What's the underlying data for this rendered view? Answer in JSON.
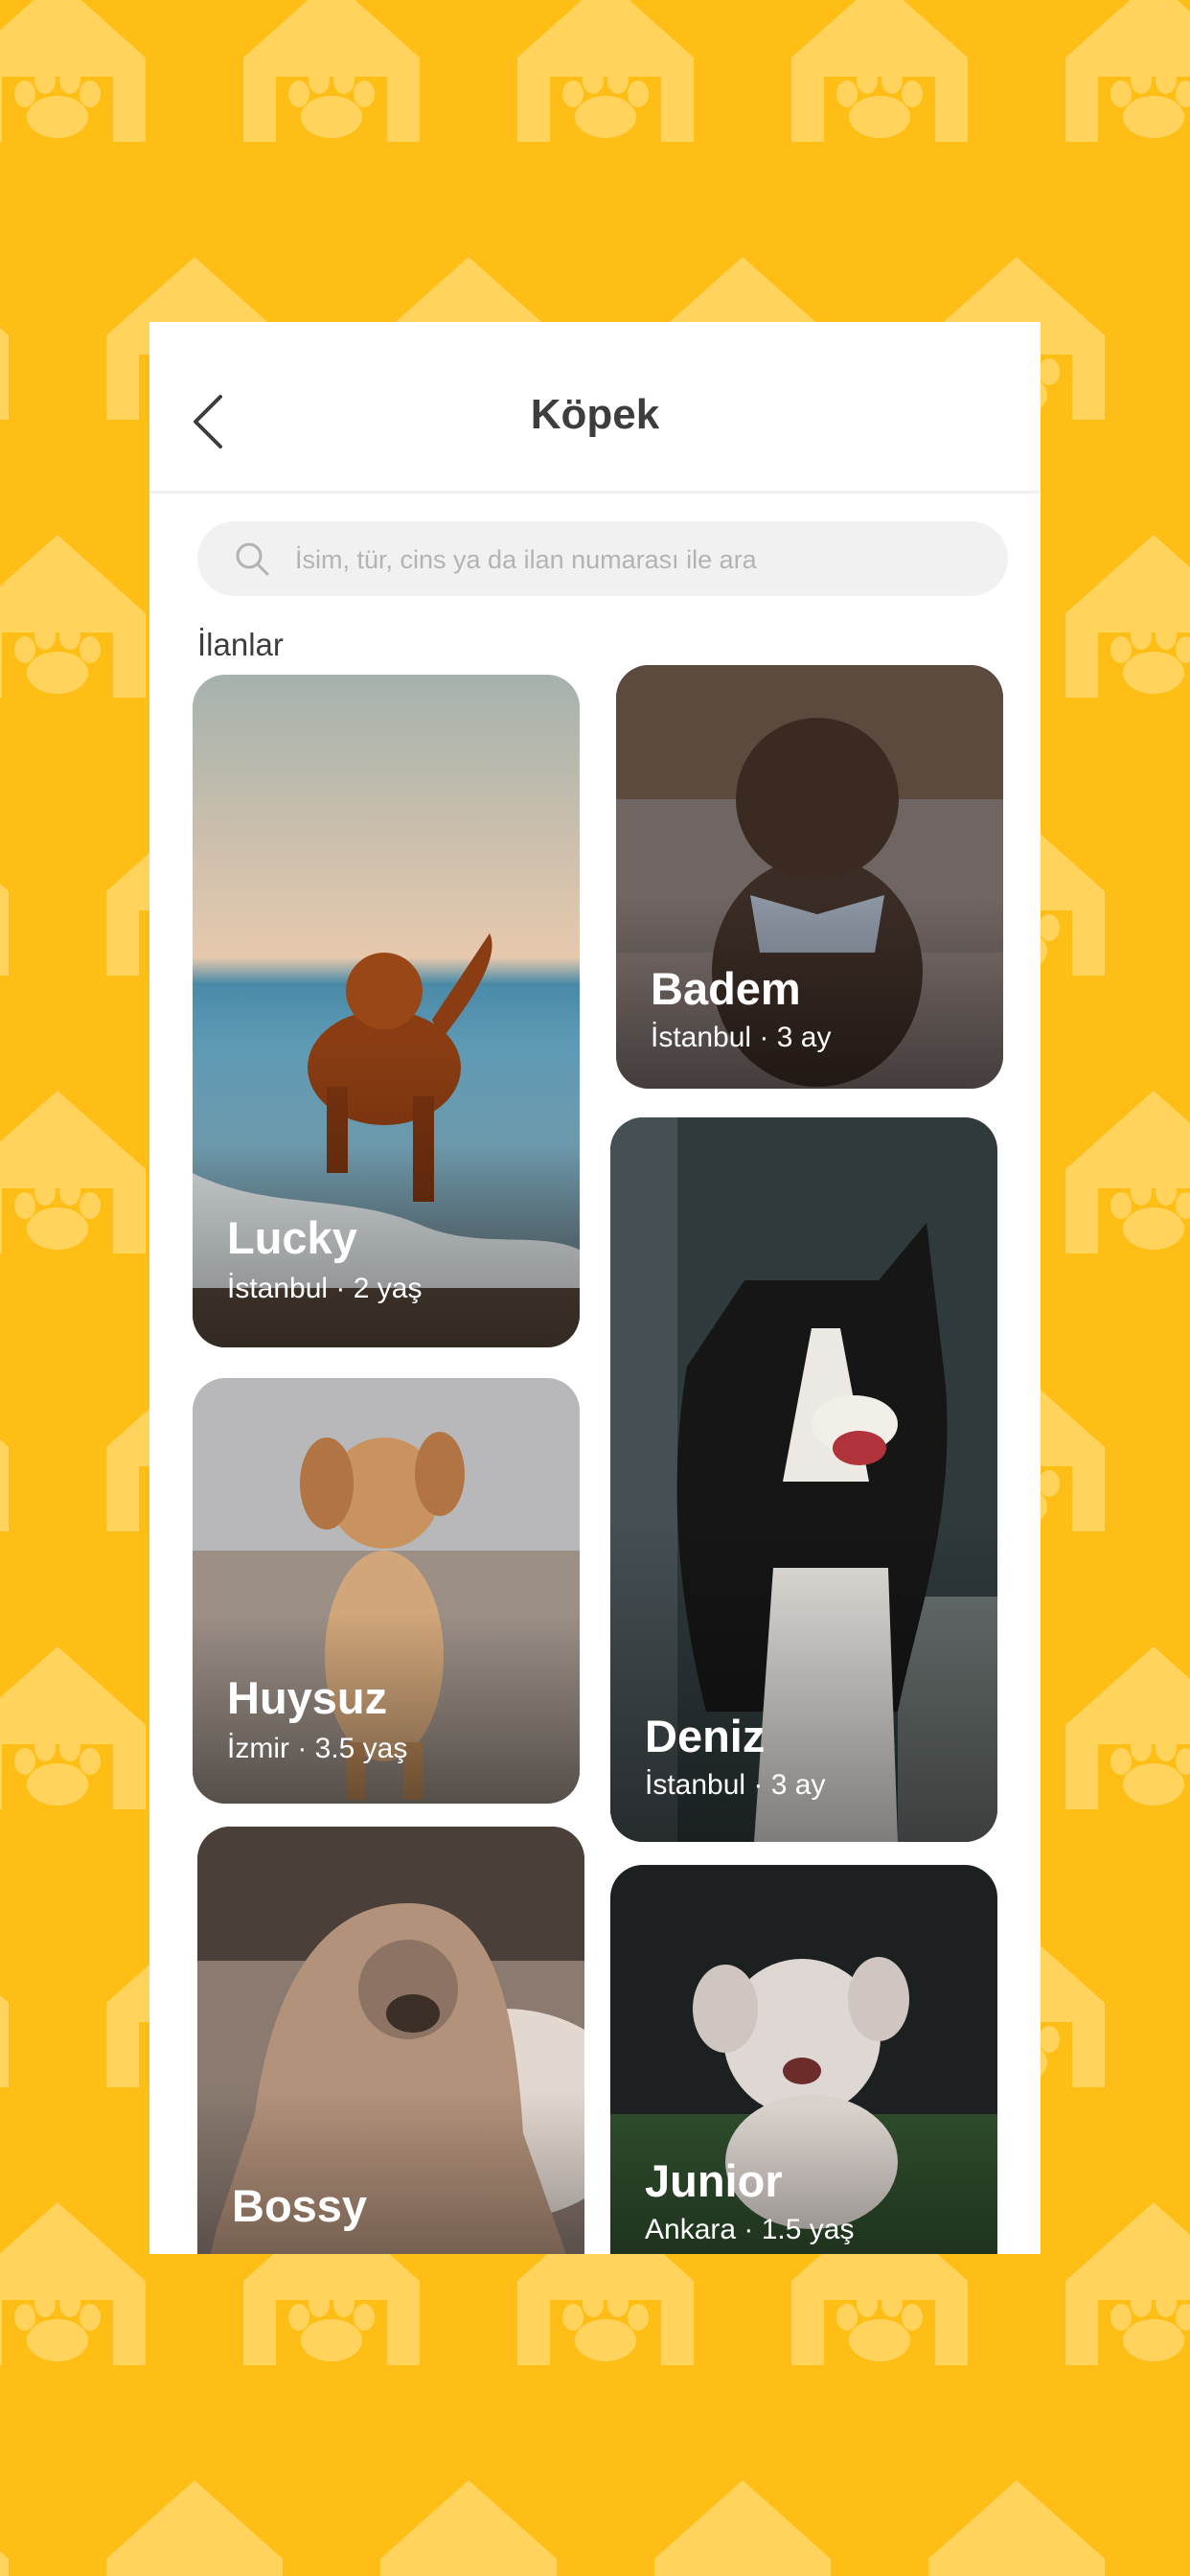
{
  "header": {
    "title": "Köpek",
    "back_icon": "chevron-left-icon"
  },
  "search": {
    "placeholder": "İsim, tür, cins ya da ilan numarası ile ara",
    "value": "",
    "icon": "search-icon"
  },
  "section": {
    "title": "İlanlar"
  },
  "listings": [
    {
      "name": "Lucky",
      "meta": "İstanbul · 2 yaş"
    },
    {
      "name": "Badem",
      "meta": "İstanbul · 3 ay"
    },
    {
      "name": "Huysuz",
      "meta": "İzmir · 3.5 yaş"
    },
    {
      "name": "Deniz",
      "meta": "İstanbul · 3 ay"
    },
    {
      "name": "Bossy",
      "meta": ""
    },
    {
      "name": "Junior",
      "meta": "Ankara · 1.5 yaş"
    }
  ],
  "colors": {
    "background": "#FFBE16",
    "pattern": "#FFD35C",
    "title_text": "#3D3D3D",
    "search_fill": "#F1F1F1"
  }
}
